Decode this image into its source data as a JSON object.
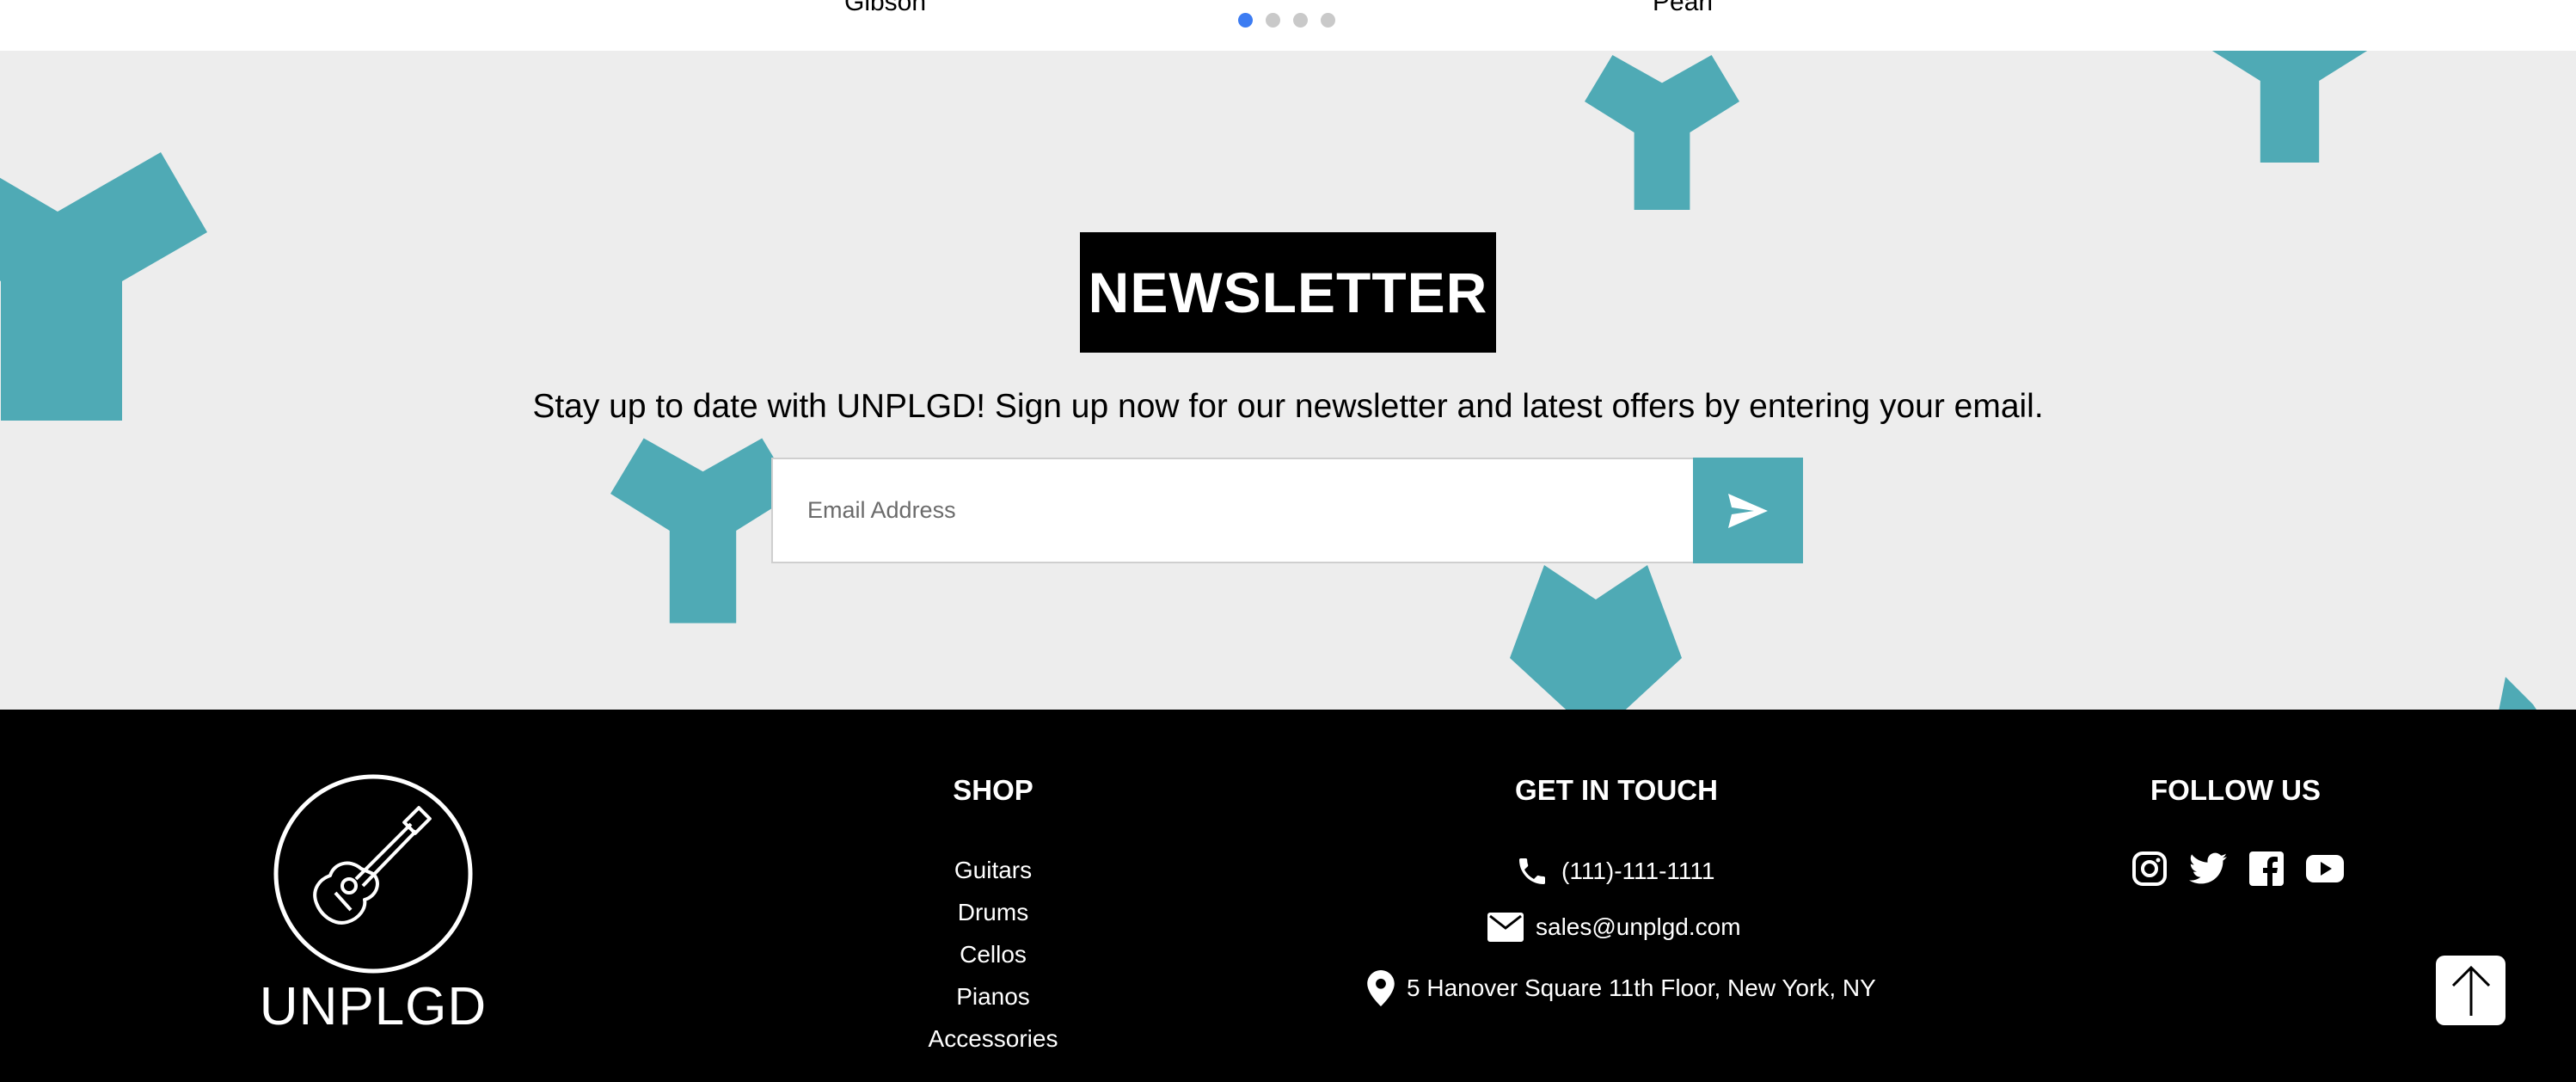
{
  "carousel": {
    "brands": [
      "Gibson",
      "Pearl"
    ],
    "dot_count": 4,
    "active_dot": 0
  },
  "newsletter": {
    "title": "NEWSLETTER",
    "description": "Stay up to date with UNPLGD! Sign up now for our newsletter and latest offers by entering your email.",
    "email_placeholder": "Email Address",
    "send_icon": "send-icon"
  },
  "footer": {
    "logo_text": "UNPLGD",
    "logo_icon": "guitar-icon",
    "shop": {
      "heading": "SHOP",
      "items": [
        "Guitars",
        "Drums",
        "Cellos",
        "Pianos",
        "Accessories"
      ]
    },
    "contact": {
      "heading": "GET IN TOUCH",
      "phone": "(111)-111-1111",
      "email": "sales@unplgd.com",
      "address": "5 Hanover Square 11th Floor, New York, NY"
    },
    "follow": {
      "heading": "FOLLOW US",
      "icons": [
        "instagram-icon",
        "twitter-icon",
        "facebook-icon",
        "youtube-icon"
      ]
    }
  },
  "back_to_top_icon": "arrow-up-icon",
  "colors": {
    "accent_teal": "#4faab5",
    "newsletter_bg": "#ededed",
    "footer_bg": "#000000",
    "active_dot": "#3c7cf2",
    "inactive_dot": "#c9c9c9"
  }
}
